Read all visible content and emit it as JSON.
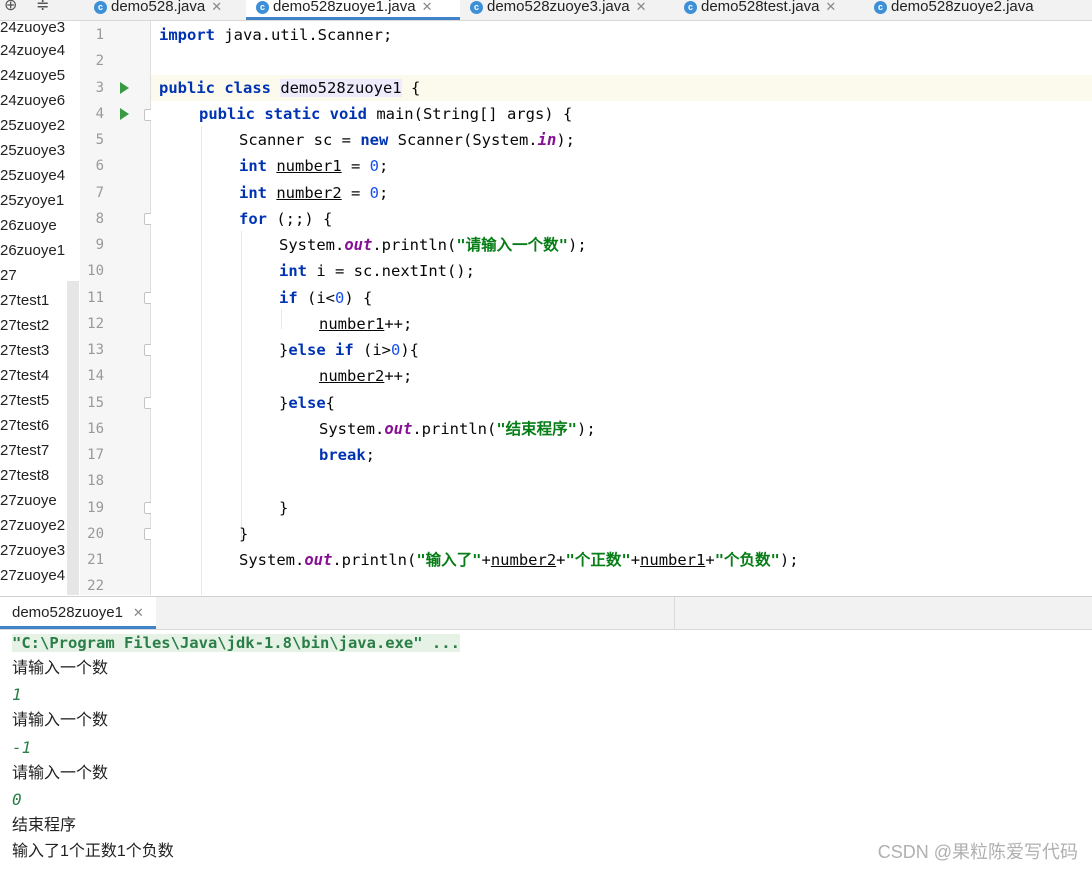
{
  "tabs": [
    {
      "label": "demo528.java"
    },
    {
      "label": "demo528zuoye1.java",
      "active": true
    },
    {
      "label": "demo528zuoye3.java"
    },
    {
      "label": "demo528test.java"
    },
    {
      "label": "demo528zuoye2.java"
    }
  ],
  "project_items": [
    "24zuoye3",
    "24zuoye4",
    "24zuoye5",
    "24zuoye6",
    "25zuoye2",
    "25zuoye3",
    "25zuoye4",
    "25zyoye1",
    "26zuoye",
    "26zuoye1",
    "27",
    "27test1",
    "27test2",
    "27test3",
    "27test4",
    "27test5",
    "27test6",
    "27test7",
    "27test8",
    "27zuoye",
    "27zuoye2",
    "27zuoye3",
    "27zuoye4"
  ],
  "code": {
    "line_numbers": [
      "1",
      "2",
      "3",
      "4",
      "5",
      "6",
      "7",
      "8",
      "9",
      "10",
      "11",
      "12",
      "13",
      "14",
      "15",
      "16",
      "17",
      "18",
      "19",
      "20",
      "21",
      "22"
    ],
    "l1": {
      "kw": "import",
      "rest": " java.util.Scanner;"
    },
    "l3": {
      "kw": "public class",
      "name": "demo528zuoye1",
      "rest": " {"
    },
    "l4": {
      "kw": "public static void",
      "rest": " main(String[] args) {"
    },
    "l5": {
      "a": "Scanner sc = ",
      "kw": "new",
      "b": " Scanner(System.",
      "st": "in",
      "c": ");"
    },
    "l6": {
      "kw": "int",
      "var": "number1",
      "a": " = ",
      "num": "0",
      "b": ";"
    },
    "l7": {
      "kw": "int",
      "var": "number2",
      "a": " = ",
      "num": "0",
      "b": ";"
    },
    "l8": {
      "kw": "for",
      "rest": " (;;) {"
    },
    "l9": {
      "a": "System.",
      "st": "out",
      "b": ".println(",
      "str": "\"请输入一个数\"",
      "c": ");"
    },
    "l10": {
      "kw": "int",
      "rest": " i = sc.nextInt();"
    },
    "l11": {
      "kw": "if",
      "a": " (i<",
      "num": "0",
      "b": ") {"
    },
    "l12": {
      "var": "number1",
      "rest": "++;"
    },
    "l13": {
      "a": "}",
      "kw": "else if",
      "b": " (i>",
      "num": "0",
      "c": "){"
    },
    "l14": {
      "var": "number2",
      "rest": "++;"
    },
    "l15": {
      "a": "}",
      "kw": "else",
      "b": "{"
    },
    "l16": {
      "a": "System.",
      "st": "out",
      "b": ".println(",
      "str": "\"结束程序\"",
      "c": ");"
    },
    "l17": {
      "kw": "break",
      "rest": ";"
    },
    "l19": {
      "rest": "}"
    },
    "l20": {
      "rest": "}"
    },
    "l21": {
      "a": "System.",
      "st": "out",
      "b": ".println(",
      "s1": "\"输入了\"",
      "p1": "+",
      "v1": "number2",
      "p2": "+",
      "s2": "\"个正数\"",
      "p3": "+",
      "v2": "number1",
      "p4": "+",
      "s3": "\"个负数\"",
      "c": ");"
    }
  },
  "run_tab": {
    "label": "demo528zuoye1"
  },
  "console": {
    "command": "\"C:\\Program Files\\Java\\jdk-1.8\\bin\\java.exe\" ...",
    "lines": [
      {
        "text": "请输入一个数",
        "type": "output"
      },
      {
        "text": "1",
        "type": "input"
      },
      {
        "text": "请输入一个数",
        "type": "output"
      },
      {
        "text": "-1",
        "type": "input"
      },
      {
        "text": "请输入一个数",
        "type": "output"
      },
      {
        "text": "0",
        "type": "input"
      },
      {
        "text": "结束程序",
        "type": "output"
      },
      {
        "text": "输入了1个正数1个负数",
        "type": "output"
      }
    ]
  },
  "watermark": "CSDN @果粒陈爱写代码",
  "icons": {
    "toolbar": [
      "target-icon",
      "collapse-icon"
    ],
    "file_type": "java-class-icon",
    "run": "run-gutter-icon"
  },
  "colors": {
    "keyword": "#0033b3",
    "string": "#067d17",
    "number": "#1750eb",
    "static_field": "#871094",
    "console_input": "#2a7e47",
    "tab_underline": "#4083c9"
  }
}
